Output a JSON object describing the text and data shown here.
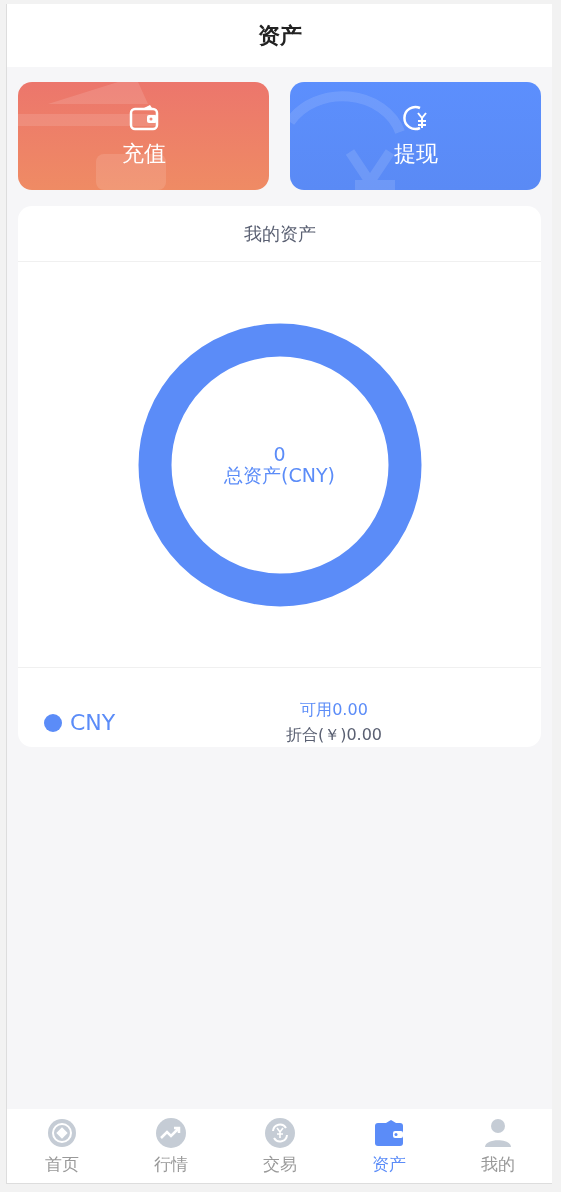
{
  "header": {
    "title": "资产"
  },
  "actions": [
    {
      "kind": "deposit",
      "label": "充值"
    },
    {
      "kind": "withdraw",
      "label": "提现"
    }
  ],
  "assets_card": {
    "title": "我的资产",
    "total_value": "0",
    "total_label": "总资产(CNY)",
    "currencies": [
      {
        "name": "CNY",
        "color": "#5b8cf8",
        "available": "可用0.00",
        "converted": "折合(￥)0.00"
      }
    ]
  },
  "tab_bar": [
    {
      "kind": "home",
      "label": "首页",
      "selected": false
    },
    {
      "kind": "market",
      "label": "行情",
      "selected": false
    },
    {
      "kind": "trade",
      "label": "交易",
      "selected": false
    },
    {
      "kind": "assets",
      "label": "资产",
      "selected": true
    },
    {
      "kind": "profile",
      "label": "我的",
      "selected": false
    }
  ]
}
